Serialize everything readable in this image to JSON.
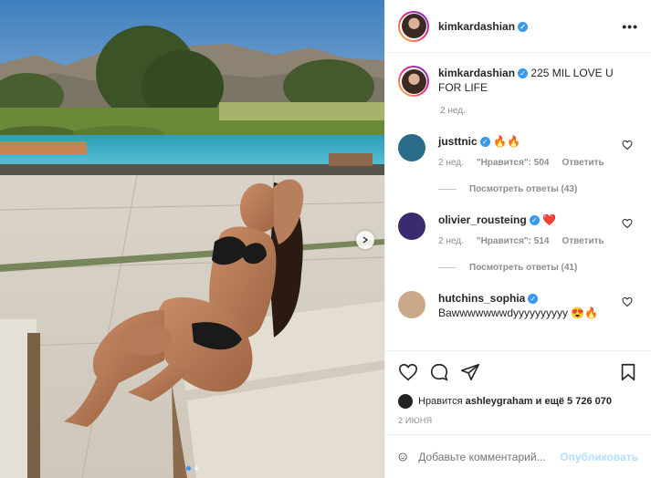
{
  "post": {
    "author": "kimkardashian",
    "verified_mark": "✓",
    "more_icon": "•••",
    "caption": "225 MIL LOVE U FOR LIFE",
    "caption_time": "2 нед.",
    "image_icon": "next-arrow",
    "slide_count": 2
  },
  "comments": [
    {
      "user": "justtnic",
      "verified": true,
      "text": "🔥🔥",
      "time": "2 нед.",
      "likes_label": "\"Нравится\": 504",
      "reply_label": "Ответить",
      "view_replies": "Посмотреть ответы (43)",
      "avatar_color": "#2a6b8a"
    },
    {
      "user": "olivier_rousteing",
      "verified": true,
      "text": "❤️",
      "time": "2 нед.",
      "likes_label": "\"Нравится\": 514",
      "reply_label": "Ответить",
      "view_replies": "Посмотреть ответы (41)",
      "avatar_color": "#3a2b6e"
    },
    {
      "user": "hutchins_sophia",
      "verified": true,
      "text": "Bawwwwwwwdyyyyyyyyyy 😍🔥",
      "avatar_color": "#c9a98a"
    }
  ],
  "likes": {
    "prefix": "Нравится",
    "user": "ashleygraham",
    "suffix": "и ещё 5 726 070"
  },
  "date": "2 ИЮНЯ",
  "add_comment": {
    "placeholder": "Добавьте комментарий...",
    "publish": "Опубликовать"
  },
  "colors": {
    "accent": "#3897f0",
    "heart_red": "#ed4956",
    "publish_disabled": "#b2dffc"
  }
}
